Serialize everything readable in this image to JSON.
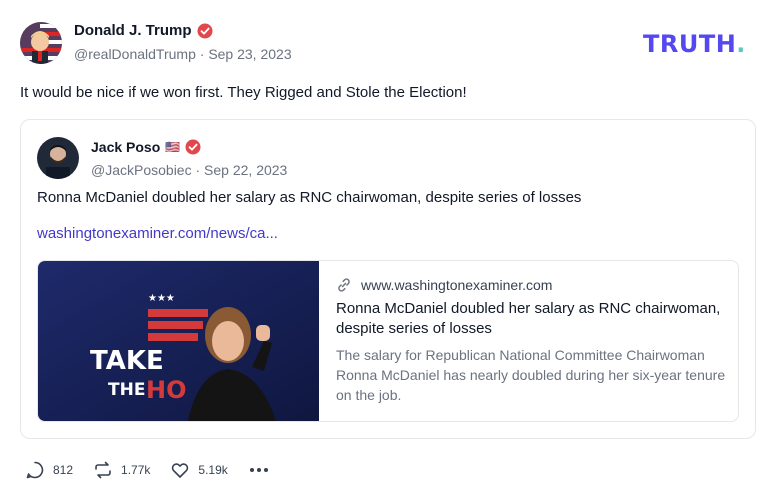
{
  "post": {
    "author_name": "Donald J. Trump",
    "author_handle": "@realDonaldTrump",
    "date": "Sep 23, 2023",
    "text": "It would be nice if we won first. They Rigged and Stole the Election!"
  },
  "brand": {
    "logo_text": "TRUTH",
    "logo_dot": "."
  },
  "quote": {
    "author_name": "Jack Poso",
    "flag": "🇺🇸",
    "author_handle": "@JackPosobiec",
    "date": "Sep 22, 2023",
    "text": "Ronna McDaniel doubled her salary as RNC chairwoman, despite series of losses",
    "link_text": "washingtonexaminer.com/news/ca...",
    "link_card": {
      "domain": "www.washingtonexaminer.com",
      "title": "Ronna McDaniel doubled her salary as RNC chairwoman, despite series of losses",
      "description": "The salary for Republican National Committee Chairwoman Ronna McDaniel has nearly doubled during her six-year tenure on the job.",
      "image_text_line1": "TAKE",
      "image_text_line2": "THE",
      "image_text_line3": "HO"
    }
  },
  "actions": {
    "replies": "812",
    "retruths": "1.77k",
    "likes": "5.19k"
  },
  "colors": {
    "brand": "#5448ee",
    "brand_dot": "#5ec9c2",
    "verified": "#e0484e",
    "link": "#4338ca"
  },
  "icons": [
    "verified-badge-icon",
    "link-icon",
    "reply-icon",
    "retruth-icon",
    "like-icon",
    "more-icon"
  ]
}
